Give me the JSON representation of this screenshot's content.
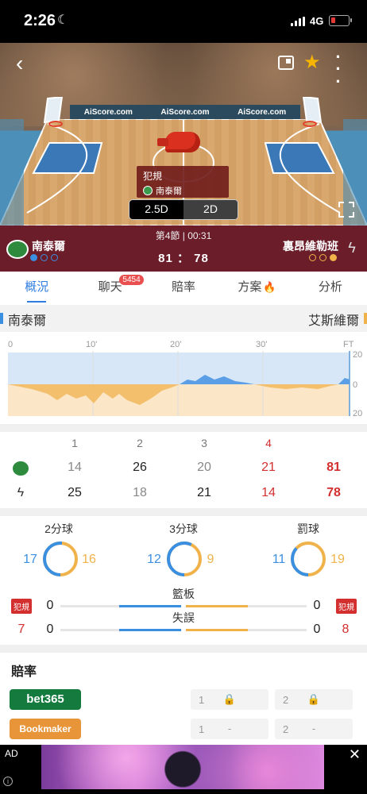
{
  "status": {
    "time": "2:26",
    "network": "4G"
  },
  "court": {
    "ad_boards": [
      "AiScore.com",
      "AiScore.com",
      "AiScore.com"
    ],
    "event": {
      "type": "犯規",
      "team": "南泰爾"
    },
    "modes": [
      "2.5D",
      "2D"
    ],
    "active_mode": "2.5D"
  },
  "scoreboard": {
    "home": "南泰爾",
    "away": "裏昂維勒班",
    "period": "第4節 | 00:31",
    "score": "81 ： 78",
    "home_timeouts": [
      "used",
      "open",
      "open"
    ],
    "away_timeouts": [
      "open",
      "open",
      "used"
    ]
  },
  "tabs": [
    {
      "label": "概況",
      "active": true
    },
    {
      "label": "聊天",
      "badge": "5454"
    },
    {
      "label": "賠率"
    },
    {
      "label": "方案"
    },
    {
      "label": "分析"
    }
  ],
  "momentum": {
    "home": "南泰爾",
    "away": "艾斯維爾",
    "x_labels": [
      "0",
      "10'",
      "20'",
      "30'",
      "FT"
    ],
    "y_labels": [
      "20",
      "0",
      "20"
    ]
  },
  "quarters": {
    "headers": [
      "1",
      "2",
      "3",
      "4",
      ""
    ],
    "home": [
      "14",
      "26",
      "20",
      "21",
      "81"
    ],
    "away": [
      "25",
      "18",
      "21",
      "14",
      "78"
    ]
  },
  "stats": {
    "rings": [
      {
        "title": "2分球",
        "home": "17",
        "away": "16",
        "home_share": 0.515
      },
      {
        "title": "3分球",
        "home": "12",
        "away": "9",
        "home_share": 0.571
      },
      {
        "title": "罰球",
        "home": "11",
        "away": "19",
        "home_share": 0.367
      }
    ],
    "rebounds": {
      "title": "籃板",
      "home": "0",
      "away": "0"
    },
    "turnovers": {
      "title": "失誤",
      "home": "0",
      "away": "0"
    },
    "fouls": {
      "label": "犯規",
      "home": "7",
      "away": "8"
    }
  },
  "odds": {
    "title": "賠率",
    "rows": [
      {
        "bookmaker": "bet365",
        "color": "#157a3d",
        "c1": "1",
        "v1": "",
        "c2": "2",
        "v2": "",
        "locked": true
      },
      {
        "bookmaker": "Bookmaker",
        "color": "#e8953a",
        "c1": "1",
        "v1": "-",
        "c2": "2",
        "v2": "-",
        "locked": false
      }
    ]
  },
  "ad": {
    "label": "AD",
    "close": "✕",
    "info": "i"
  },
  "colors": {
    "accent": "#2f7de1",
    "home": "#3b8fe0",
    "away": "#f0b24a",
    "score_bg": "#6b1d2a",
    "red": "#d32f2f"
  }
}
